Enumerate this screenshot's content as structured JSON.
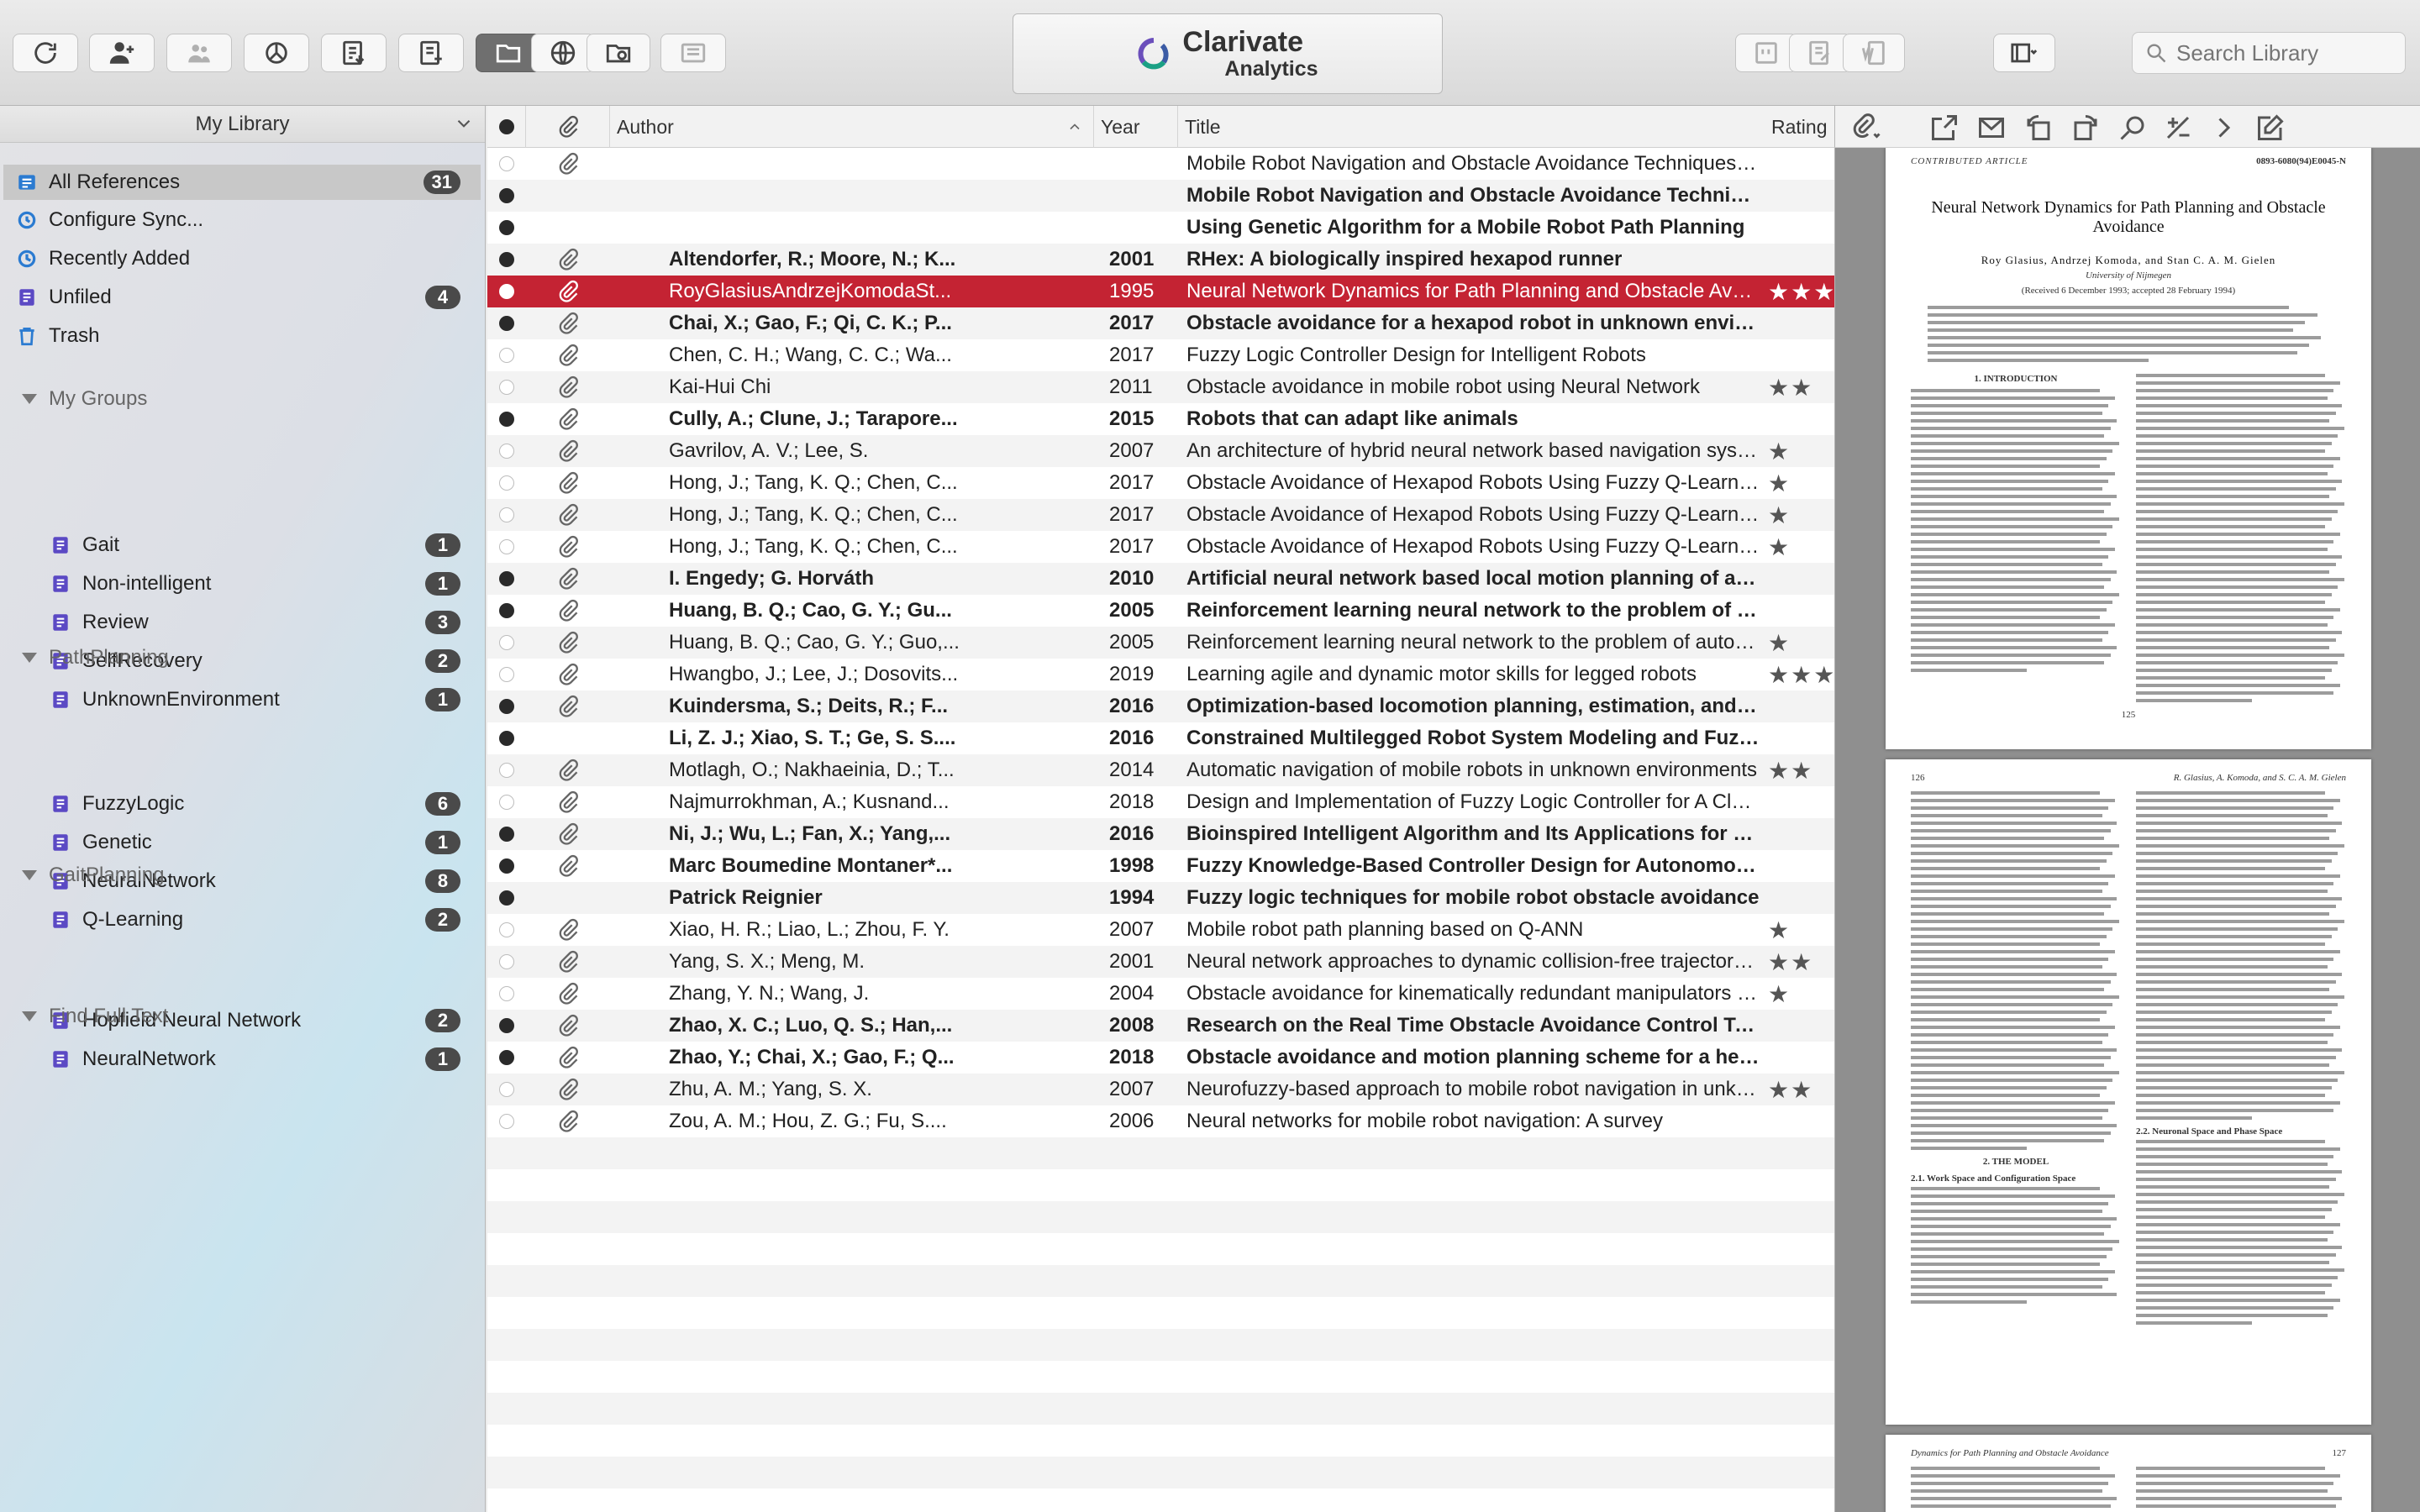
{
  "brand": {
    "name": "Clarivate",
    "sub": "Analytics"
  },
  "search": {
    "placeholder": "Search Library"
  },
  "sidebar": {
    "header": "My Library",
    "items": [
      {
        "label": "All References",
        "count": "31",
        "icon": "all-references-icon"
      },
      {
        "label": "Configure Sync...",
        "count": "",
        "icon": "sync-icon"
      },
      {
        "label": "Recently Added",
        "count": "",
        "icon": "clock-icon"
      },
      {
        "label": "Unfiled",
        "count": "4",
        "icon": "unfiled-icon"
      },
      {
        "label": "Trash",
        "count": "",
        "icon": "trash-icon"
      }
    ],
    "sections": [
      {
        "title": "My Groups",
        "groups": [
          {
            "label": "Gait",
            "count": "1"
          },
          {
            "label": "Non-intelligent",
            "count": "1"
          },
          {
            "label": "Review",
            "count": "3"
          },
          {
            "label": "SelfRecovery",
            "count": "2"
          },
          {
            "label": "UnknownEnvironment",
            "count": "1"
          }
        ]
      },
      {
        "title": "PathPlanning",
        "groups": [
          {
            "label": "FuzzyLogic",
            "count": "6"
          },
          {
            "label": "Genetic",
            "count": "1"
          },
          {
            "label": "NeuralNetwork",
            "count": "8"
          },
          {
            "label": "Q-Learning",
            "count": "2"
          }
        ]
      },
      {
        "title": "GaitPlanning",
        "groups": [
          {
            "label": "Hopfield Neural Network",
            "count": "2"
          },
          {
            "label": "NeuralNetwork",
            "count": "1"
          }
        ]
      },
      {
        "title": "Find Full Text",
        "groups": []
      }
    ]
  },
  "columns": {
    "author": "Author",
    "year": "Year",
    "title": "Title",
    "rating": "Rating"
  },
  "references": [
    {
      "read": true,
      "attach": true,
      "author": "",
      "year": "",
      "title": "Mobile Robot Navigation and Obstacle Avoidance Techniques: A Review",
      "rating": ""
    },
    {
      "read": false,
      "attach": false,
      "author": "",
      "year": "",
      "title": "Mobile Robot Navigation and Obstacle Avoidance Techniques: A Review",
      "rating": ""
    },
    {
      "read": false,
      "attach": false,
      "author": "",
      "year": "",
      "title": "Using Genetic Algorithm for a Mobile Robot Path Planning",
      "rating": ""
    },
    {
      "read": false,
      "attach": true,
      "author": "Altendorfer, R.; Moore, N.; K...",
      "year": "2001",
      "title": "RHex: A biologically inspired hexapod runner",
      "rating": ""
    },
    {
      "read": true,
      "attach": true,
      "author": "RoyGlasiusAndrzejKomodaSt...",
      "year": "1995",
      "title": "Neural Network Dynamics for Path Planning and Obstacle Avoidance",
      "rating": "★★★",
      "selected": true
    },
    {
      "read": false,
      "attach": true,
      "author": "Chai, X.; Gao, F.; Qi, C. K.; P...",
      "year": "2017",
      "title": "Obstacle avoidance for a hexapod robot in unknown environment",
      "rating": ""
    },
    {
      "read": true,
      "attach": true,
      "author": "Chen, C. H.; Wang, C. C.; Wa...",
      "year": "2017",
      "title": "Fuzzy Logic Controller Design for Intelligent Robots",
      "rating": ""
    },
    {
      "read": true,
      "attach": true,
      "author": "Kai-Hui Chi",
      "year": "2011",
      "title": "Obstacle avoidance in mobile robot using Neural Network",
      "rating": "★★"
    },
    {
      "read": false,
      "attach": true,
      "author": "Cully, A.; Clune, J.; Tarapore...",
      "year": "2015",
      "title": "Robots that can adapt like animals",
      "rating": ""
    },
    {
      "read": true,
      "attach": true,
      "author": "Gavrilov, A. V.; Lee, S.",
      "year": "2007",
      "title": "An architecture of hybrid neural network based navigation system for mobil...",
      "rating": "★"
    },
    {
      "read": true,
      "attach": true,
      "author": "Hong, J.; Tang, K. Q.; Chen, C...",
      "year": "2017",
      "title": "Obstacle Avoidance of Hexapod Robots Using Fuzzy Q-Learning",
      "rating": "★"
    },
    {
      "read": true,
      "attach": true,
      "author": "Hong, J.; Tang, K. Q.; Chen, C...",
      "year": "2017",
      "title": "Obstacle Avoidance of Hexapod Robots Using Fuzzy Q-Learning",
      "rating": "★"
    },
    {
      "read": true,
      "attach": true,
      "author": "Hong, J.; Tang, K. Q.; Chen, C...",
      "year": "2017",
      "title": "Obstacle Avoidance of Hexapod Robots Using Fuzzy Q-Learning",
      "rating": "★"
    },
    {
      "read": false,
      "attach": true,
      "author": "I. Engedy; G. Horváth",
      "year": "2010",
      "title": "Artificial neural network based local motion planning of a wheeled mo...",
      "rating": ""
    },
    {
      "read": false,
      "attach": true,
      "author": "Huang, B. Q.; Cao, G. Y.; Gu...",
      "year": "2005",
      "title": "Reinforcement learning neural network to the problem of autonomous...",
      "rating": ""
    },
    {
      "read": true,
      "attach": true,
      "author": "Huang, B. Q.; Cao, G. Y.; Guo,...",
      "year": "2005",
      "title": "Reinforcement learning neural network to the problem of autonomous mobil...",
      "rating": "★"
    },
    {
      "read": true,
      "attach": true,
      "author": "Hwangbo, J.; Lee, J.; Dosovits...",
      "year": "2019",
      "title": "Learning agile and dynamic motor skills for legged robots",
      "rating": "★★★"
    },
    {
      "read": false,
      "attach": true,
      "author": "Kuindersma, S.; Deits, R.; F...",
      "year": "2016",
      "title": "Optimization-based locomotion planning, estimation, and control desi...",
      "rating": ""
    },
    {
      "read": false,
      "attach": false,
      "author": "Li, Z. J.; Xiao, S. T.; Ge, S. S....",
      "year": "2016",
      "title": "Constrained Multilegged Robot System Modeling and Fuzzy Control W...",
      "rating": ""
    },
    {
      "read": true,
      "attach": true,
      "author": "Motlagh, O.; Nakhaeinia, D.; T...",
      "year": "2014",
      "title": "Automatic navigation of mobile robots in unknown environments",
      "rating": "★★"
    },
    {
      "read": true,
      "attach": true,
      "author": "Najmurrokhman, A.; Kusnand...",
      "year": "2018",
      "title": "Design and Implementation of Fuzzy Logic Controller for A Class of Hexapo...",
      "rating": ""
    },
    {
      "read": false,
      "attach": true,
      "author": "Ni, J.; Wu, L.; Fan, X.; Yang,...",
      "year": "2016",
      "title": "Bioinspired Intelligent Algorithm and Its Applications for Mobile Robot...",
      "rating": ""
    },
    {
      "read": false,
      "attach": true,
      "author": "Marc Boumedine Montaner*...",
      "year": "1998",
      "title": "Fuzzy Knowledge-Based Controller Design for Autonomous Robot Na...",
      "rating": ""
    },
    {
      "read": false,
      "attach": false,
      "author": "Patrick Reignier",
      "year": "1994",
      "title": "Fuzzy logic techniques for mobile robot obstacle avoidance",
      "rating": ""
    },
    {
      "read": true,
      "attach": true,
      "author": "Xiao, H. R.; Liao, L.; Zhou, F. Y.",
      "year": "2007",
      "title": "Mobile robot path planning based on Q-ANN",
      "rating": "★"
    },
    {
      "read": true,
      "attach": true,
      "author": "Yang, S. X.; Meng, M.",
      "year": "2001",
      "title": "Neural network approaches to dynamic collision-free trajectory generation",
      "rating": "★★"
    },
    {
      "read": true,
      "attach": true,
      "author": "Zhang, Y. N.; Wang, J.",
      "year": "2004",
      "title": "Obstacle avoidance for kinematically redundant manipulators using a dual n...",
      "rating": "★"
    },
    {
      "read": false,
      "attach": true,
      "author": "Zhao, X. C.; Luo, Q. S.; Han,...",
      "year": "2008",
      "title": "Research on the Real Time Obstacle Avoidance Control Technology of...",
      "rating": ""
    },
    {
      "read": false,
      "attach": true,
      "author": "Zhao, Y.; Chai, X.; Gao, F.; Q...",
      "year": "2018",
      "title": "Obstacle avoidance and motion planning scheme for a hexapod robot...",
      "rating": ""
    },
    {
      "read": true,
      "attach": true,
      "author": "Zhu, A. M.; Yang, S. X.",
      "year": "2007",
      "title": "Neurofuzzy-based approach to mobile robot navigation in unknown environ...",
      "rating": "★★"
    },
    {
      "read": true,
      "attach": true,
      "author": "Zou, A. M.; Hou, Z. G.; Fu, S....",
      "year": "2006",
      "title": "Neural networks for mobile robot navigation: A survey",
      "rating": ""
    }
  ],
  "preview": {
    "page1": {
      "label": "CONTRIBUTED ARTICLE",
      "code": "0893-6080(94)E0045-N",
      "title": "Neural Network Dynamics for Path Planning and Obstacle Avoidance",
      "authors": "Roy Glasius, Andrzej Komoda, and Stan C. A. M. Gielen",
      "affil": "University of Nijmegen",
      "received": "(Received 6 December 1993; accepted 28 February 1994)",
      "intro": "1. INTRODUCTION",
      "pageno": "125"
    },
    "page2": {
      "pageno": "126",
      "running": "R. Glasius, A. Komoda, and S. C. A. M. Gielen",
      "section": "2. THE MODEL",
      "sub1": "2.1. Work Space and Configuration Space",
      "sub2": "2.2. Neuronal Space and Phase Space"
    },
    "page3": {
      "running": "Dynamics for Path Planning and Obstacle Avoidance",
      "pageno": "127"
    }
  }
}
